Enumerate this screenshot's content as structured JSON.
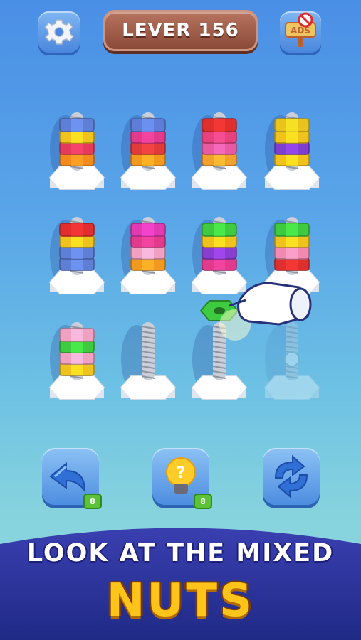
{
  "header": {
    "level_label": "LEVER 156",
    "settings_icon": "gear-icon",
    "no_ads_icon": "no-ads-sign-icon",
    "no_ads_text": "ADS"
  },
  "board": {
    "columns": [
      {
        "nuts": [
          "#f28a1e",
          "#e53a5c",
          "#f0c21d",
          "#5f7fd6"
        ],
        "state": "normal"
      },
      {
        "nuts": [
          "#f29a1f",
          "#e03a3a",
          "#e23a8c",
          "#5d7dd9"
        ],
        "state": "normal"
      },
      {
        "nuts": [
          "#f2a22c",
          "#e85aa2",
          "#e8427e",
          "#e0302e"
        ],
        "state": "normal"
      },
      {
        "nuts": [
          "#f2c21b",
          "#7e3ed0",
          "#f0c21d",
          "#e9c31e"
        ],
        "state": "normal"
      },
      {
        "nuts": [
          "#5f7fd6",
          "#5f7fd6",
          "#f0c21d",
          "#e22e2e"
        ],
        "state": "normal"
      },
      {
        "nuts": [
          "#f29a1f",
          "#f0a0c0",
          "#e23a8c",
          "#e23ab2"
        ],
        "state": "normal"
      },
      {
        "nuts": [
          "#e23a8c",
          "#8a3ed0",
          "#f0c21d",
          "#3fcb3f"
        ],
        "state": "normal"
      },
      {
        "nuts": [
          "#e0302e",
          "#f08ab0",
          "#f0c21d",
          "#3fcb3f"
        ],
        "state": "normal"
      },
      {
        "nuts": [
          "#f0c21d",
          "#f0a0c0",
          "#3fcb3f",
          "#f0a0c0"
        ],
        "state": "normal"
      },
      {
        "nuts": [],
        "state": "empty"
      },
      {
        "nuts": [],
        "state": "empty",
        "lifted_nut": "#3fcb3f"
      },
      {
        "nuts": [],
        "state": "locked"
      }
    ],
    "hand_icon": "pointing-hand-icon"
  },
  "controls": {
    "undo": {
      "icon": "undo-arrow-icon",
      "count": "8"
    },
    "hint": {
      "icon": "lightbulb-question-icon",
      "count": "8"
    },
    "shuffle": {
      "icon": "refresh-arrows-icon",
      "count": ""
    }
  },
  "banner": {
    "line1": "LOOK AT THE MIXED",
    "line2": "NUTS"
  }
}
